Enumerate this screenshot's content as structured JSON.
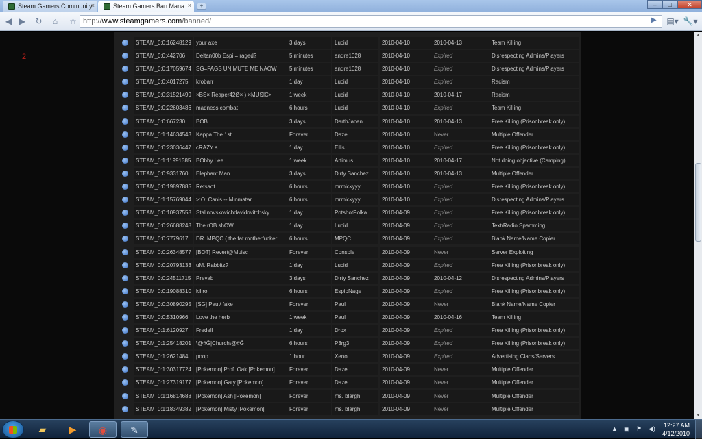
{
  "browser": {
    "tabs": [
      {
        "label": "Steam Gamers Community",
        "active": false
      },
      {
        "label": "Steam Gamers Ban Mana...",
        "active": true
      }
    ],
    "url_scheme": "http://",
    "url_host": "www.steamgamers.com",
    "url_path": "/banned/"
  },
  "page": {
    "page_number": "2"
  },
  "bans": [
    {
      "steam": "STEAM_0:0:16248129",
      "name": "your axe",
      "length": "3 days",
      "admin": "Lucid",
      "date": "2010-04-10",
      "expires": "2010-04-13",
      "reason": "Team Killing"
    },
    {
      "steam": "STEAM_0:0:442706",
      "name": "Deltan00b Espi = raged?",
      "length": "5 minutes",
      "admin": "andre1028",
      "date": "2010-04-10",
      "expires": "Expired",
      "reason": "Disrespecting Admins/Players"
    },
    {
      "steam": "STEAM_0:0:17059674",
      "name": "SG=FAGS UN MUTE ME NAOW",
      "length": "5 minutes",
      "admin": "andre1028",
      "date": "2010-04-10",
      "expires": "Expired",
      "reason": "Disrespecting Admins/Players"
    },
    {
      "steam": "STEAM_0:0:4017275",
      "name": "krobarr",
      "length": "1 day",
      "admin": "Lucid",
      "date": "2010-04-10",
      "expires": "Expired",
      "reason": "Racism"
    },
    {
      "steam": "STEAM_0:0:31521499",
      "name": "×BS× Reaper42Ø× ) ×MUSIC×",
      "length": "1 week",
      "admin": "Lucid",
      "date": "2010-04-10",
      "expires": "2010-04-17",
      "reason": "Racism"
    },
    {
      "steam": "STEAM_0:0:22603486",
      "name": "madness combat",
      "length": "6 hours",
      "admin": "Lucid",
      "date": "2010-04-10",
      "expires": "Expired",
      "reason": "Team Killing"
    },
    {
      "steam": "STEAM_0:0:667230",
      "name": "BOB",
      "length": "3 days",
      "admin": "DarthJacen",
      "date": "2010-04-10",
      "expires": "2010-04-13",
      "reason": "Free Killing (Prisonbreak only)"
    },
    {
      "steam": "STEAM_0:1:14634543",
      "name": "Kappa The 1st",
      "length": "Forever",
      "admin": "Daze",
      "date": "2010-04-10",
      "expires": "Never",
      "reason": "Multiple Offender"
    },
    {
      "steam": "STEAM_0:0:23036447",
      "name": "cRAZY s",
      "length": "1 day",
      "admin": "Ellis",
      "date": "2010-04-10",
      "expires": "Expired",
      "reason": "Free Killing (Prisonbreak only)"
    },
    {
      "steam": "STEAM_0:1:11991385",
      "name": "BObby Lee",
      "length": "1 week",
      "admin": "Artimus",
      "date": "2010-04-10",
      "expires": "2010-04-17",
      "reason": "Not doing objective (Camping)"
    },
    {
      "steam": "STEAM_0:0:9331760",
      "name": "Elephant Man",
      "length": "3 days",
      "admin": "Dirty Sanchez",
      "date": "2010-04-10",
      "expires": "2010-04-13",
      "reason": "Multiple Offender"
    },
    {
      "steam": "STEAM_0:0:19897885",
      "name": "Retsaot",
      "length": "6 hours",
      "admin": "mrmickyyy",
      "date": "2010-04-10",
      "expires": "Expired",
      "reason": "Free Killing (Prisonbreak only)"
    },
    {
      "steam": "STEAM_0:1:15769044",
      "name": ">:O: Canis -- Minmatar",
      "length": "6 hours",
      "admin": "mrmickyyy",
      "date": "2010-04-10",
      "expires": "Expired",
      "reason": "Disrespecting Admins/Players"
    },
    {
      "steam": "STEAM_0:0:10937558",
      "name": "Stalinovskovichdavidovitchsky",
      "length": "1 day",
      "admin": "PotshotPolka",
      "date": "2010-04-09",
      "expires": "Expired",
      "reason": "Free Killing (Prisonbreak only)"
    },
    {
      "steam": "STEAM_0:0:26688248",
      "name": "The rOB shOW",
      "length": "1 day",
      "admin": "Lucid",
      "date": "2010-04-09",
      "expires": "Expired",
      "reason": "Text/Radio Spamming"
    },
    {
      "steam": "STEAM_0:0:7779617",
      "name": "DR. MPQC ( the fat motherfucker",
      "length": "6 hours",
      "admin": "MPQC",
      "date": "2010-04-09",
      "expires": "Expired",
      "reason": "Blank Name/Name Copier"
    },
    {
      "steam": "STEAM_0:0:26348577",
      "name": "[BOT] Revert@Muisc",
      "length": "Forever",
      "admin": "Console",
      "date": "2010-04-09",
      "expires": "Never",
      "reason": "Server Exploiting"
    },
    {
      "steam": "STEAM_0:0:20793133",
      "name": "uM. Rabbitz?",
      "length": "1 day",
      "admin": "Lucid",
      "date": "2010-04-09",
      "expires": "Expired",
      "reason": "Free Killing (Prisonbreak only)"
    },
    {
      "steam": "STEAM_0:0:24511715",
      "name": "Prevab",
      "length": "3 days",
      "admin": "Dirty Sanchez",
      "date": "2010-04-09",
      "expires": "2010-04-12",
      "reason": "Disrespecting Admins/Players"
    },
    {
      "steam": "STEAM_0:0:19088310",
      "name": "killro",
      "length": "6 hours",
      "admin": "EspioNage",
      "date": "2010-04-09",
      "expires": "Expired",
      "reason": "Free Killing (Prisonbreak only)"
    },
    {
      "steam": "STEAM_0:0:30890295",
      "name": "[SG] Paul/ fake",
      "length": "Forever",
      "admin": "Paul",
      "date": "2010-04-09",
      "expires": "Never",
      "reason": "Blank Name/Name Copier"
    },
    {
      "steam": "STEAM_0:0:5310966",
      "name": "Love the herb",
      "length": "1 week",
      "admin": "Paul",
      "date": "2010-04-09",
      "expires": "2010-04-16",
      "reason": "Team Killing"
    },
    {
      "steam": "STEAM_0:1:6120927",
      "name": "Fredell",
      "length": "1 day",
      "admin": "Drox",
      "date": "2010-04-09",
      "expires": "Expired",
      "reason": "Free Killing (Prisonbreak only)"
    },
    {
      "steam": "STEAM_0:1:25418201",
      "name": "\\@#Ĝ|Church\\@#Ĝ",
      "length": "6 hours",
      "admin": "P3rg3",
      "date": "2010-04-09",
      "expires": "Expired",
      "reason": "Free Killing (Prisonbreak only)"
    },
    {
      "steam": "STEAM_0:1:2621484",
      "name": "poop",
      "length": "1 hour",
      "admin": "Xeno",
      "date": "2010-04-09",
      "expires": "Expired",
      "reason": "Advertising Clans/Servers"
    },
    {
      "steam": "STEAM_0:1:30317724",
      "name": "[Pokemon] Prof. Oak [Pokemon]",
      "length": "Forever",
      "admin": "Daze",
      "date": "2010-04-09",
      "expires": "Never",
      "reason": "Multiple Offender"
    },
    {
      "steam": "STEAM_0:1:27319177",
      "name": "[Pokemon] Gary [Pokemon]",
      "length": "Forever",
      "admin": "Daze",
      "date": "2010-04-09",
      "expires": "Never",
      "reason": "Multiple Offender"
    },
    {
      "steam": "STEAM_0:1:16814688",
      "name": "[Pokemon] Ash [Pokemon]",
      "length": "Forever",
      "admin": "ms. blargh",
      "date": "2010-04-09",
      "expires": "Never",
      "reason": "Multiple Offender"
    },
    {
      "steam": "STEAM_0:1:18349382",
      "name": "[Pokemon] Misty [Pokemon]",
      "length": "Forever",
      "admin": "ms. blargh",
      "date": "2010-04-09",
      "expires": "Never",
      "reason": "Multiple Offender"
    }
  ],
  "taskbar": {
    "clock_time": "12:27 AM",
    "clock_date": "4/12/2010"
  },
  "icons": {
    "info": "info-icon",
    "favicon": "steam-gamers-favicon"
  },
  "colors": {
    "page_number": "#c0211b",
    "panel_bg": "#1f1f1f",
    "cell_bg": "#191919"
  }
}
